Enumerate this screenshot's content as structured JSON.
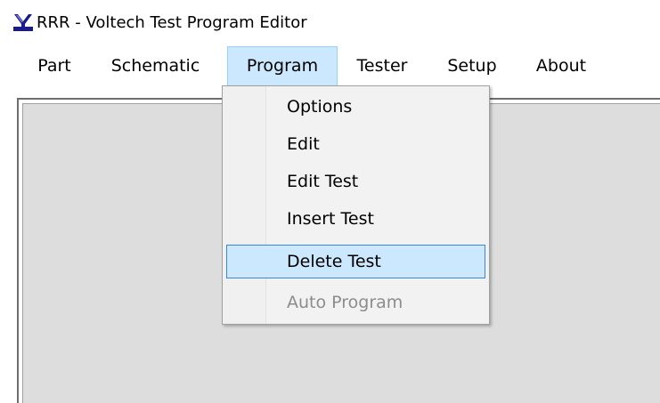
{
  "window": {
    "title": "RRR - Voltech Test Program Editor",
    "icon": "voltech-app-icon"
  },
  "menubar": {
    "items": [
      {
        "label": "Part"
      },
      {
        "label": "Schematic"
      },
      {
        "label": "Program",
        "active": true
      },
      {
        "label": "Tester"
      },
      {
        "label": "Setup"
      },
      {
        "label": "About"
      }
    ]
  },
  "program_menu": {
    "items": [
      {
        "label": "Options",
        "enabled": true
      },
      {
        "label": "Edit",
        "enabled": true
      },
      {
        "label": "Edit Test",
        "enabled": true
      },
      {
        "label": "Insert Test",
        "enabled": true
      },
      {
        "label": "Delete Test",
        "enabled": true,
        "highlighted": true
      },
      {
        "label": "Auto Program",
        "enabled": false
      }
    ]
  },
  "colors": {
    "menu_highlight_bg": "#cce8ff",
    "menu_highlight_border": "#3d86d6",
    "client_area_bg": "#dddddd",
    "disabled_text": "#8c8c8c"
  }
}
